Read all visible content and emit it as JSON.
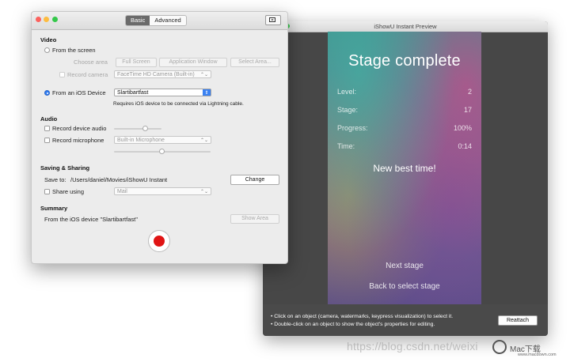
{
  "preview": {
    "title": "iShowU Instant Preview",
    "stage_title": "Stage complete",
    "stats": [
      {
        "label": "Level:",
        "value": "2"
      },
      {
        "label": "Stage:",
        "value": "17"
      },
      {
        "label": "Progress:",
        "value": "100%"
      },
      {
        "label": "Time:",
        "value": "0:14"
      }
    ],
    "best_time": "New best time!",
    "next_stage": "Next stage",
    "back_to_select": "Back to select stage",
    "hint1": "• Click on an object (camera, watermarks, keypress visualization) to select it.",
    "hint2": "• Double-click on an object to show the object's properties for editing.",
    "reattach": "Reattach"
  },
  "settings": {
    "tabs": [
      "Basic",
      "Advanced"
    ],
    "video_heading": "Video",
    "from_screen": "From the screen",
    "choose_area": "Choose area",
    "full_screen": "Full Screen",
    "application_window": "Application Window",
    "select_area": "Select Area...",
    "record_camera": "Record camera",
    "camera_device": "FaceTime HD Camera (Built-in)",
    "from_ios": "From an iOS Device",
    "ios_device": "Slartibartfast",
    "ios_note": "Requires iOS device to be connected via Lightning cable.",
    "audio_heading": "Audio",
    "record_device_audio": "Record device audio",
    "record_microphone": "Record microphone",
    "microphone": "Built-in Microphone",
    "device_audio_level": 0.5,
    "microphone_level": 0.5,
    "saving_heading": "Saving & Sharing",
    "save_to_label": "Save to:",
    "save_path": "/Users/daniel/Movies/iShowU Instant",
    "change": "Change",
    "share_using": "Share using",
    "share_service": "Mail",
    "summary_heading": "Summary",
    "summary_text": "From the iOS device \"Slartibartfast\"",
    "show_area": "Show Area"
  },
  "watermark": {
    "url": "https://blog.csdn.net/weixi",
    "site_cn": "Mac下载",
    "site_url": "www.macdown.com"
  }
}
